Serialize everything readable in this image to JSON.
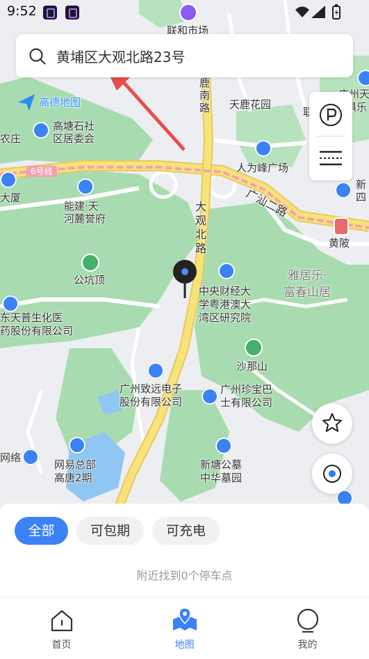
{
  "status_bar": {
    "time": "9:52"
  },
  "search": {
    "query": "黄埔区大观北路23号"
  },
  "map": {
    "logo_text": "高德地图",
    "labels": {
      "lianhe_market": "联和市场",
      "tianlu_nanlu": "鹿南路",
      "tianlu_garden": "天鹿花园",
      "gaotang_shishe": "高塘石社",
      "gaotang_jwh": "区居委会",
      "chuangzhuang": "农庄",
      "renweifeng": "人为峰广场",
      "line6": "6号线",
      "dasha": "大厦",
      "nengjian1": "能建·天",
      "nengjian2": "河麓誉府",
      "daguan_beilu": "大观北路",
      "guangshan_road": "广汕二路",
      "huangbei": "黄陂",
      "gongkengding": "公坑顶",
      "yaju1": "雅居乐·",
      "yaju2": "富春山居",
      "cufe1": "中央财经大",
      "cufe2": "学粤港澳大",
      "cufe3": "湾区研究院",
      "tianpu1": "东天普生化医",
      "tianpu2": "药股份有限公司",
      "shanashan": "沙那山",
      "zhiyuan1": "广州致远电子",
      "zhiyuan2": "股份有限公司",
      "zhenbao1": "广州珍宝巴",
      "zhenbao2": "士有限公司",
      "netease_left": "网络",
      "netease1": "网易总部",
      "netease2": "高唐2期",
      "xintang1": "新塘公墓",
      "xintang2": "中华墓园",
      "guangzhou_tian1": "广州天",
      "guangzhou_tian2": "俱乐",
      "xin_si1": "新",
      "xin_si2": "四",
      "lian_vertical": "联"
    }
  },
  "panel": {
    "chips": [
      "全部",
      "可包期",
      "可充电"
    ],
    "empty_message": "附近找到0个停车点"
  },
  "tabs": [
    {
      "label": "首页",
      "icon": "home-icon"
    },
    {
      "label": "地图",
      "icon": "map-pin-icon"
    },
    {
      "label": "我的",
      "icon": "profile-icon"
    }
  ],
  "colors": {
    "accent": "#3b82f6",
    "road_yellow": "#f6dd6a",
    "metro_pink": "#f2a1b5",
    "green_area": "#a8dcb0"
  }
}
